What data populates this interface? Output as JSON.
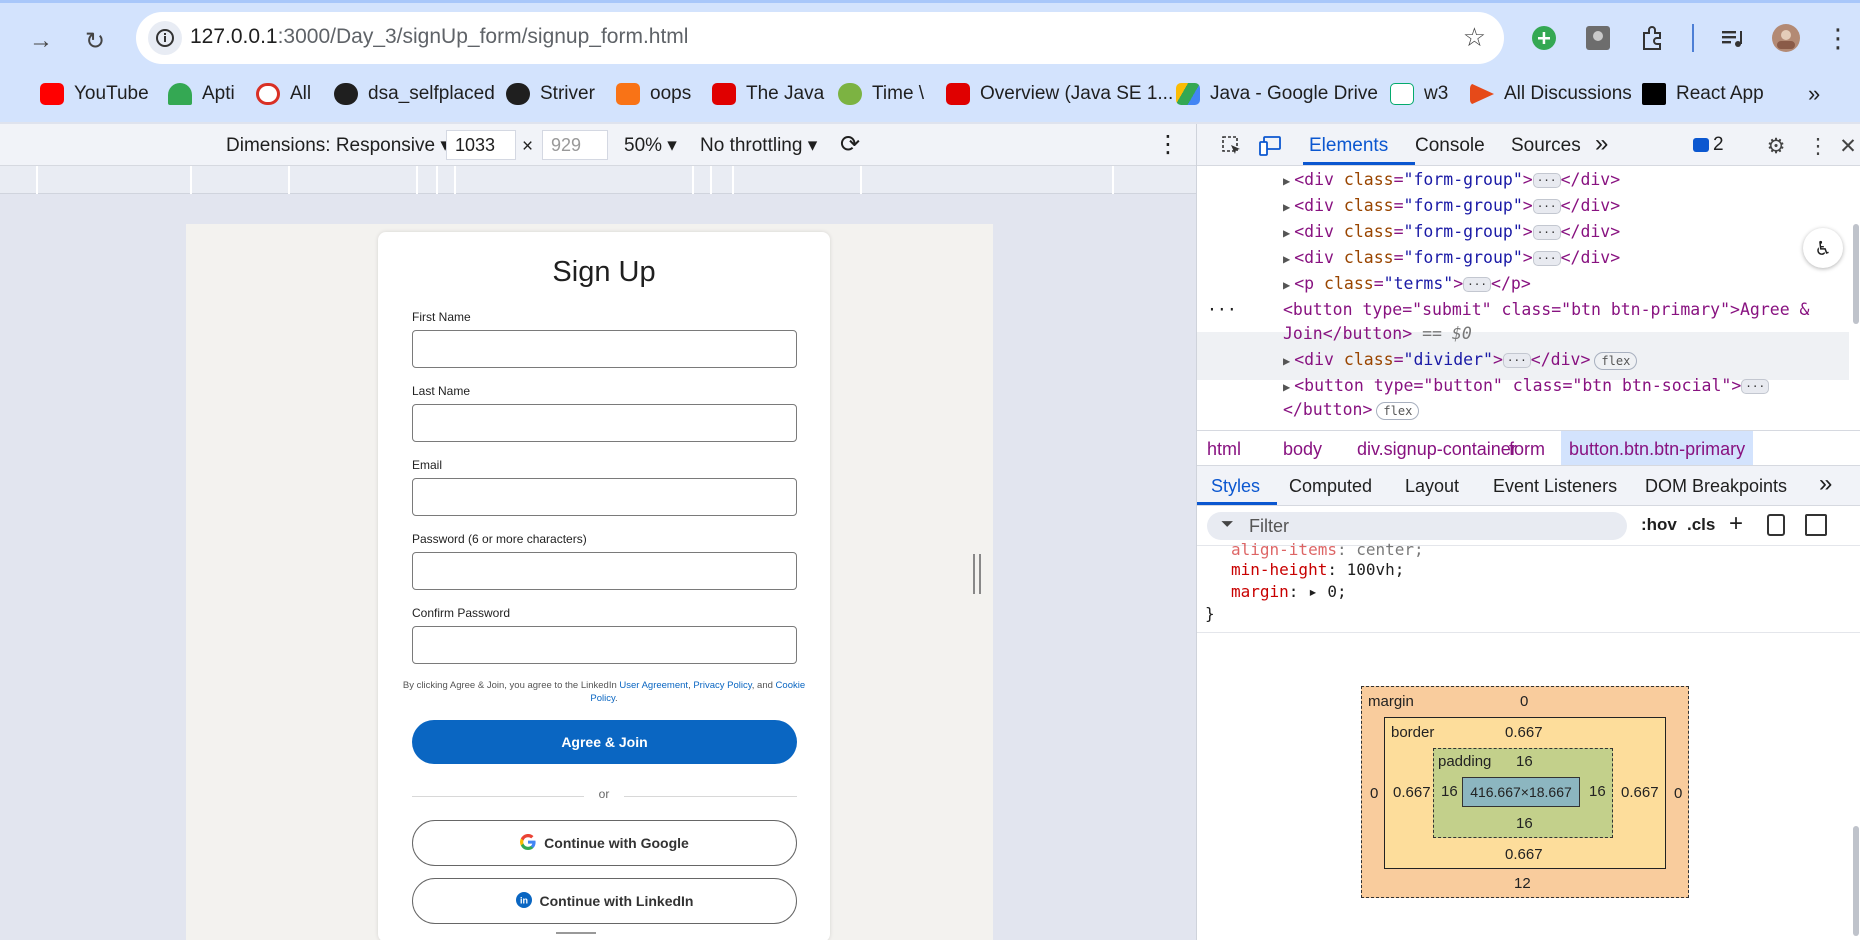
{
  "browser": {
    "url_host": "127.0.0.1",
    "url_path": ":3000/Day_3/signUp_form/signup_form.html",
    "bookmarks": [
      {
        "label": "YouTube",
        "icon": "youtube-icon",
        "color": "#ff0000"
      },
      {
        "label": "Apti",
        "icon": "umbrella-icon",
        "color": "#34a853"
      },
      {
        "label": "All",
        "icon": "site-icon",
        "color": "#d93025"
      },
      {
        "label": "dsa_selfplaced",
        "icon": "github-icon",
        "color": "#1f1f1f"
      },
      {
        "label": "Striver",
        "icon": "tuf-icon",
        "color": "#1f1f1f"
      },
      {
        "label": "oops",
        "icon": "code-icon",
        "color": "#f97316"
      },
      {
        "label": "The Java",
        "icon": "oracle-icon",
        "color": "#e00000"
      },
      {
        "label": "Time \\",
        "icon": "check-icon",
        "color": "#7cb342"
      },
      {
        "label": "Overview (Java SE 1...",
        "icon": "oracle-icon",
        "color": "#e00000"
      },
      {
        "label": "Java - Google Drive",
        "icon": "drive-icon",
        "color": "#fbbc04"
      },
      {
        "label": "w3",
        "icon": "w3-icon",
        "color": "#04aa6d"
      },
      {
        "label": "All Discussions",
        "icon": "flag-icon",
        "color": "#e64a19"
      },
      {
        "label": "React App",
        "icon": "react-app-icon",
        "color": "#000000"
      }
    ]
  },
  "device_toolbar": {
    "dimensions": "Dimensions: Responsive",
    "width": "1033",
    "x": "×",
    "height": "929",
    "zoom": "50%",
    "throttling": "No throttling"
  },
  "page": {
    "title": "Sign Up",
    "fields": [
      {
        "label": "First Name"
      },
      {
        "label": "Last Name"
      },
      {
        "label": "Email"
      },
      {
        "label": "Password (6 or more characters)"
      },
      {
        "label": "Confirm Password"
      }
    ],
    "terms_prefix": "By clicking Agree & Join, you agree to the LinkedIn ",
    "terms_link1": "User Agreement",
    "terms_sep1": ", ",
    "terms_link2": "Privacy Policy",
    "terms_sep2": ", and ",
    "terms_link3": "Cookie Policy",
    "terms_end": ".",
    "primary_button": "Agree & Join",
    "divider": "or",
    "google_button": "Continue with Google",
    "linkedin_button": "Continue with LinkedIn"
  },
  "devtools": {
    "tabs": [
      "Elements",
      "Console",
      "Sources"
    ],
    "issues_count": "2",
    "dom": [
      {
        "tag": "div",
        "class": "form-group"
      },
      {
        "tag": "div",
        "class": "form-group"
      },
      {
        "tag": "div",
        "class": "form-group"
      },
      {
        "tag": "div",
        "class": "form-group"
      },
      {
        "tag": "p",
        "class": "terms"
      }
    ],
    "selected_line1": "<button type=\"submit\" class=\"btn btn-primary\">Agree &",
    "selected_line2": "Join</button>",
    "selected_marker": "== $0",
    "divider_node": {
      "tag": "div",
      "class": "divider",
      "badge": "flex"
    },
    "social_node_line1": "<button type=\"button\" class=\"btn btn-social\">",
    "social_node_line2": "</button>",
    "social_badge": "flex",
    "breadcrumbs": [
      "html",
      "body",
      "div.signup-container",
      "form",
      "button.btn.btn-primary"
    ],
    "sub_tabs": [
      "Styles",
      "Computed",
      "Layout",
      "Event Listeners",
      "DOM Breakpoints"
    ],
    "filter_placeholder": "Filter",
    "filter_hov": ":hov",
    "filter_cls": ".cls",
    "css": [
      {
        "prop": "align-items",
        "value": "center;"
      },
      {
        "prop": "min-height",
        "value": "100vh;"
      },
      {
        "prop": "margin",
        "value": "0;"
      }
    ],
    "css_close": "}",
    "box_model": {
      "margin_label": "margin",
      "margin_top": "0",
      "margin_bottom": "12",
      "margin_left": "0",
      "margin_right": "0",
      "border_label": "border",
      "border_top": "0.667",
      "border_bottom": "0.667",
      "border_left": "0.667",
      "border_right": "0.667",
      "padding_label": "padding",
      "padding_top": "16",
      "padding_bottom": "16",
      "padding_left": "16",
      "padding_right": "16",
      "content": "416.667×18.667"
    }
  }
}
